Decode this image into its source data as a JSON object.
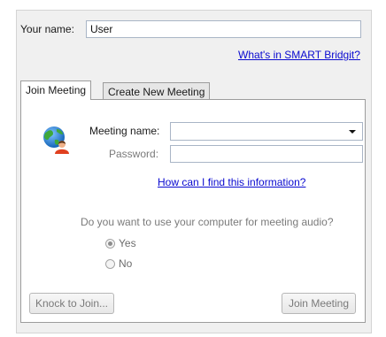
{
  "name_row": {
    "label": "Your name:",
    "value": "User"
  },
  "links": {
    "whats_in": "What's in SMART Bridgit?",
    "how_find": "How can I find this information?"
  },
  "tabs": [
    {
      "label": "Join Meeting",
      "active": true
    },
    {
      "label": "Create New Meeting",
      "active": false
    }
  ],
  "join": {
    "meeting_label": "Meeting name:",
    "meeting_value": "",
    "password_label": "Password:",
    "password_value": "",
    "audio_question": "Do you want to use your computer for meeting audio?",
    "radio_yes": "Yes",
    "radio_no": "No",
    "radio_selected": "Yes",
    "knock_button": "Knock to Join...",
    "join_button": "Join Meeting"
  },
  "icons": {
    "globe": "globe-user-icon",
    "dropdown": "chevron-down-icon"
  },
  "colors": {
    "link": "#0a0ad0",
    "input_border": "#a9b5c6",
    "disabled_text": "#7a7a7a"
  }
}
